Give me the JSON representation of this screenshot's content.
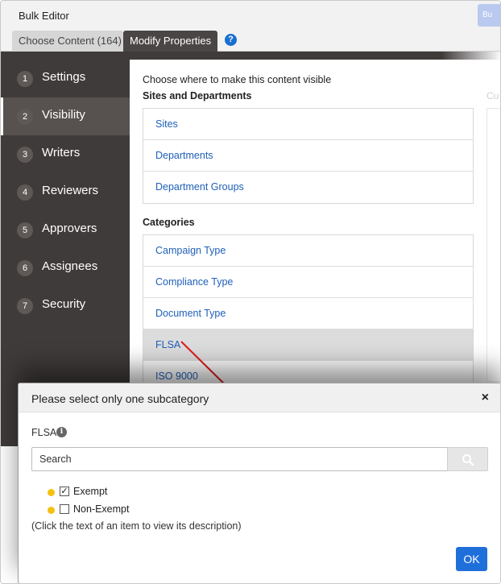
{
  "window": {
    "title": "Bulk Editor",
    "corner_button_label": "Bu"
  },
  "tabs": [
    {
      "label": "Choose Content (164)"
    },
    {
      "label": "Modify Properties"
    }
  ],
  "help_icon": "?",
  "sidebar": {
    "items": [
      {
        "num": "1",
        "label": "Settings"
      },
      {
        "num": "2",
        "label": "Visibility",
        "active": true
      },
      {
        "num": "3",
        "label": "Writers"
      },
      {
        "num": "4",
        "label": "Reviewers"
      },
      {
        "num": "5",
        "label": "Approvers"
      },
      {
        "num": "6",
        "label": "Assignees"
      },
      {
        "num": "7",
        "label": "Security"
      }
    ]
  },
  "main": {
    "intro": "Choose where to make this content visible",
    "sites_heading": "Sites and Departments",
    "sites_items": [
      "Sites",
      "Departments",
      "Department Groups"
    ],
    "categories_heading": "Categories",
    "category_items": [
      "Campaign Type",
      "Compliance Type",
      "Document Type",
      "FLSA",
      "ISO 9000"
    ],
    "selected_category": "FLSA",
    "right_column_label": "Cu"
  },
  "dialog": {
    "title": "Please select only one subcategory",
    "close_label": "×",
    "field_label": "FLSA",
    "info_icon": "i",
    "search_placeholder": "Search",
    "options": [
      {
        "label": "Exempt",
        "checked": true,
        "check_mark": "✓"
      },
      {
        "label": "Non-Exempt",
        "checked": false,
        "check_mark": ""
      }
    ],
    "hint": "(Click the text of an item to view its description)",
    "ok_label": "OK"
  },
  "colors": {
    "sidebar_bg": "#3f3b3a",
    "link": "#1f5fb8",
    "primary_button": "#1f6fdb",
    "status_dot": "#f5c010",
    "annotation_arrow": "#e01a1a"
  }
}
